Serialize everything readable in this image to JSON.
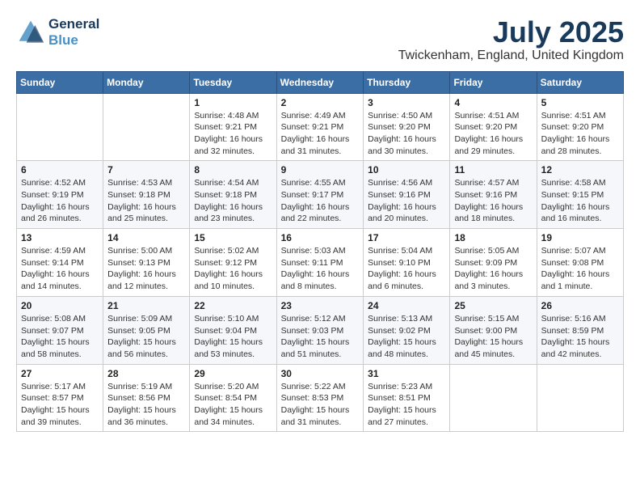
{
  "logo": {
    "line1": "General",
    "line2": "Blue"
  },
  "title": {
    "month_year": "July 2025",
    "location": "Twickenham, England, United Kingdom"
  },
  "days_of_week": [
    "Sunday",
    "Monday",
    "Tuesday",
    "Wednesday",
    "Thursday",
    "Friday",
    "Saturday"
  ],
  "weeks": [
    [
      {
        "day": "",
        "sunrise": "",
        "sunset": "",
        "daylight": ""
      },
      {
        "day": "",
        "sunrise": "",
        "sunset": "",
        "daylight": ""
      },
      {
        "day": "1",
        "sunrise": "Sunrise: 4:48 AM",
        "sunset": "Sunset: 9:21 PM",
        "daylight": "Daylight: 16 hours and 32 minutes."
      },
      {
        "day": "2",
        "sunrise": "Sunrise: 4:49 AM",
        "sunset": "Sunset: 9:21 PM",
        "daylight": "Daylight: 16 hours and 31 minutes."
      },
      {
        "day": "3",
        "sunrise": "Sunrise: 4:50 AM",
        "sunset": "Sunset: 9:20 PM",
        "daylight": "Daylight: 16 hours and 30 minutes."
      },
      {
        "day": "4",
        "sunrise": "Sunrise: 4:51 AM",
        "sunset": "Sunset: 9:20 PM",
        "daylight": "Daylight: 16 hours and 29 minutes."
      },
      {
        "day": "5",
        "sunrise": "Sunrise: 4:51 AM",
        "sunset": "Sunset: 9:20 PM",
        "daylight": "Daylight: 16 hours and 28 minutes."
      }
    ],
    [
      {
        "day": "6",
        "sunrise": "Sunrise: 4:52 AM",
        "sunset": "Sunset: 9:19 PM",
        "daylight": "Daylight: 16 hours and 26 minutes."
      },
      {
        "day": "7",
        "sunrise": "Sunrise: 4:53 AM",
        "sunset": "Sunset: 9:18 PM",
        "daylight": "Daylight: 16 hours and 25 minutes."
      },
      {
        "day": "8",
        "sunrise": "Sunrise: 4:54 AM",
        "sunset": "Sunset: 9:18 PM",
        "daylight": "Daylight: 16 hours and 23 minutes."
      },
      {
        "day": "9",
        "sunrise": "Sunrise: 4:55 AM",
        "sunset": "Sunset: 9:17 PM",
        "daylight": "Daylight: 16 hours and 22 minutes."
      },
      {
        "day": "10",
        "sunrise": "Sunrise: 4:56 AM",
        "sunset": "Sunset: 9:16 PM",
        "daylight": "Daylight: 16 hours and 20 minutes."
      },
      {
        "day": "11",
        "sunrise": "Sunrise: 4:57 AM",
        "sunset": "Sunset: 9:16 PM",
        "daylight": "Daylight: 16 hours and 18 minutes."
      },
      {
        "day": "12",
        "sunrise": "Sunrise: 4:58 AM",
        "sunset": "Sunset: 9:15 PM",
        "daylight": "Daylight: 16 hours and 16 minutes."
      }
    ],
    [
      {
        "day": "13",
        "sunrise": "Sunrise: 4:59 AM",
        "sunset": "Sunset: 9:14 PM",
        "daylight": "Daylight: 16 hours and 14 minutes."
      },
      {
        "day": "14",
        "sunrise": "Sunrise: 5:00 AM",
        "sunset": "Sunset: 9:13 PM",
        "daylight": "Daylight: 16 hours and 12 minutes."
      },
      {
        "day": "15",
        "sunrise": "Sunrise: 5:02 AM",
        "sunset": "Sunset: 9:12 PM",
        "daylight": "Daylight: 16 hours and 10 minutes."
      },
      {
        "day": "16",
        "sunrise": "Sunrise: 5:03 AM",
        "sunset": "Sunset: 9:11 PM",
        "daylight": "Daylight: 16 hours and 8 minutes."
      },
      {
        "day": "17",
        "sunrise": "Sunrise: 5:04 AM",
        "sunset": "Sunset: 9:10 PM",
        "daylight": "Daylight: 16 hours and 6 minutes."
      },
      {
        "day": "18",
        "sunrise": "Sunrise: 5:05 AM",
        "sunset": "Sunset: 9:09 PM",
        "daylight": "Daylight: 16 hours and 3 minutes."
      },
      {
        "day": "19",
        "sunrise": "Sunrise: 5:07 AM",
        "sunset": "Sunset: 9:08 PM",
        "daylight": "Daylight: 16 hours and 1 minute."
      }
    ],
    [
      {
        "day": "20",
        "sunrise": "Sunrise: 5:08 AM",
        "sunset": "Sunset: 9:07 PM",
        "daylight": "Daylight: 15 hours and 58 minutes."
      },
      {
        "day": "21",
        "sunrise": "Sunrise: 5:09 AM",
        "sunset": "Sunset: 9:05 PM",
        "daylight": "Daylight: 15 hours and 56 minutes."
      },
      {
        "day": "22",
        "sunrise": "Sunrise: 5:10 AM",
        "sunset": "Sunset: 9:04 PM",
        "daylight": "Daylight: 15 hours and 53 minutes."
      },
      {
        "day": "23",
        "sunrise": "Sunrise: 5:12 AM",
        "sunset": "Sunset: 9:03 PM",
        "daylight": "Daylight: 15 hours and 51 minutes."
      },
      {
        "day": "24",
        "sunrise": "Sunrise: 5:13 AM",
        "sunset": "Sunset: 9:02 PM",
        "daylight": "Daylight: 15 hours and 48 minutes."
      },
      {
        "day": "25",
        "sunrise": "Sunrise: 5:15 AM",
        "sunset": "Sunset: 9:00 PM",
        "daylight": "Daylight: 15 hours and 45 minutes."
      },
      {
        "day": "26",
        "sunrise": "Sunrise: 5:16 AM",
        "sunset": "Sunset: 8:59 PM",
        "daylight": "Daylight: 15 hours and 42 minutes."
      }
    ],
    [
      {
        "day": "27",
        "sunrise": "Sunrise: 5:17 AM",
        "sunset": "Sunset: 8:57 PM",
        "daylight": "Daylight: 15 hours and 39 minutes."
      },
      {
        "day": "28",
        "sunrise": "Sunrise: 5:19 AM",
        "sunset": "Sunset: 8:56 PM",
        "daylight": "Daylight: 15 hours and 36 minutes."
      },
      {
        "day": "29",
        "sunrise": "Sunrise: 5:20 AM",
        "sunset": "Sunset: 8:54 PM",
        "daylight": "Daylight: 15 hours and 34 minutes."
      },
      {
        "day": "30",
        "sunrise": "Sunrise: 5:22 AM",
        "sunset": "Sunset: 8:53 PM",
        "daylight": "Daylight: 15 hours and 31 minutes."
      },
      {
        "day": "31",
        "sunrise": "Sunrise: 5:23 AM",
        "sunset": "Sunset: 8:51 PM",
        "daylight": "Daylight: 15 hours and 27 minutes."
      },
      {
        "day": "",
        "sunrise": "",
        "sunset": "",
        "daylight": ""
      },
      {
        "day": "",
        "sunrise": "",
        "sunset": "",
        "daylight": ""
      }
    ]
  ]
}
